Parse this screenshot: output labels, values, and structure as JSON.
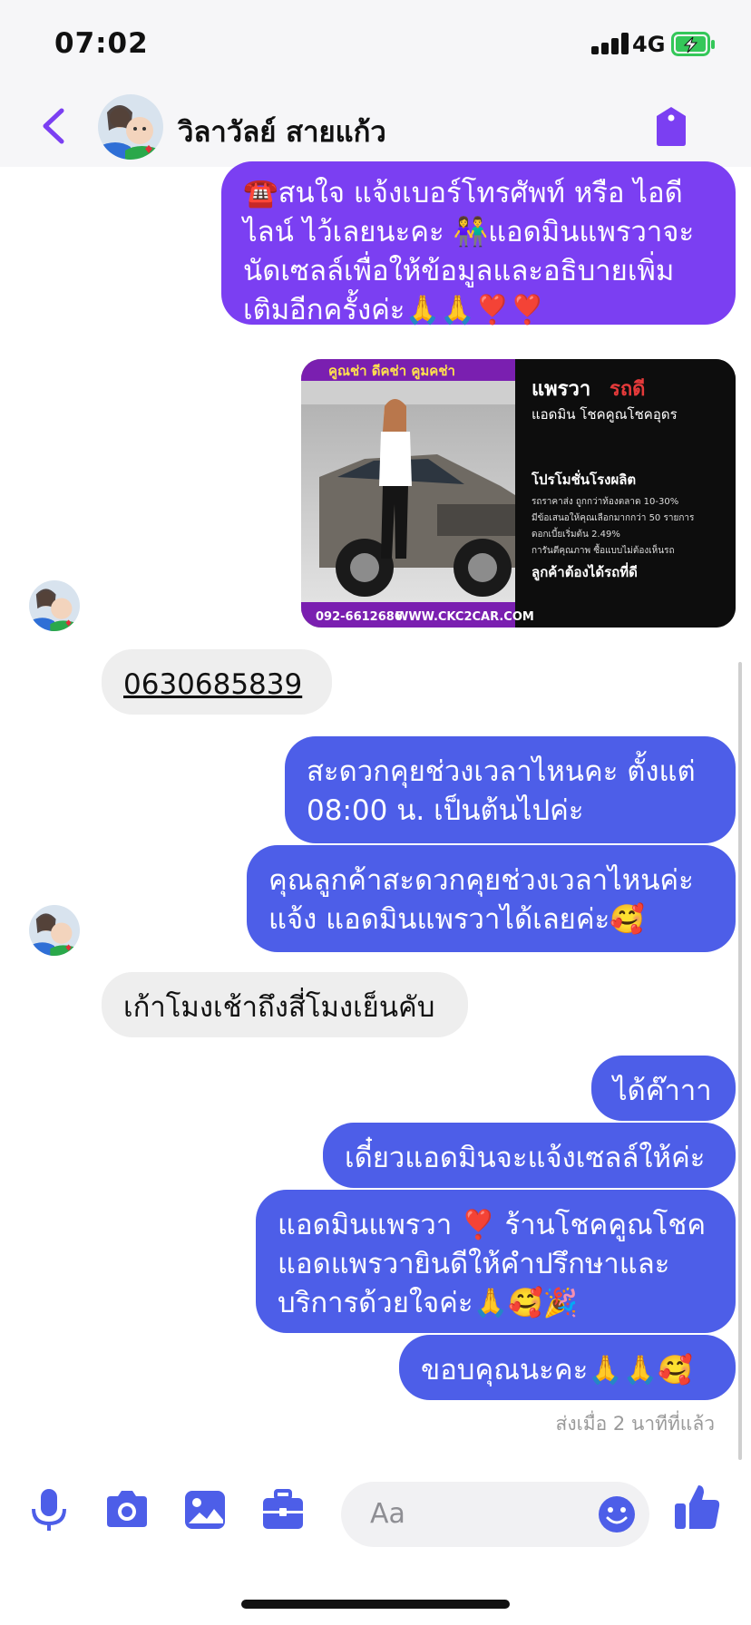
{
  "status": {
    "time": "07:02",
    "network": "4G"
  },
  "header": {
    "contact_name": "วิลาวัลย์ สายแก้ว"
  },
  "colors": {
    "accent": "#7b3ff2",
    "sent_purple": "#7b3ff2",
    "sent_indigo": "#4d5ee8",
    "received_gray": "#eeeeee"
  },
  "messages": {
    "m1": "☎️สนใจ แจ้งเบอร์โทรศัพท์ หรือ ไอดีไลน์  ไว้เลยนะคะ 👫แอดมินแพรวาจะนัดเซลล์เพื่อให้ข้อมูลและอธิบายเพิ่มเติมอีกครั้งค่ะ🙏🙏❣️❣️",
    "m2": "0630685839",
    "m3": "สะดวกคุยช่วงเวลาไหนคะ ตั้งแต่ 08:00 น. เป็นต้นไปค่ะ",
    "m4": "คุณลูกค้าสะดวกคุยช่วงเวลาไหนค่ะแจ้ง แอดมินแพรวาได้เลยค่ะ🥰",
    "m5": "เก้าโมงเช้าถึงสี่โมงเย็นคับ",
    "m6": "ได้ค๊าาา",
    "m7": "เดี๋ยวแอดมินจะแจ้งเซลล์ให้ค่ะ",
    "m8": "แอดมินแพรวา ❣️ ร้านโชคคูณโชคแอดแพรวายินดีให้คำปรึกษาและบริการด้วยใจค่ะ🙏🥰🎉",
    "m9": "ขอบคุณนะคะ🙏🙏🥰"
  },
  "ad": {
    "banner": "คูณช่า ดีคช่า คูมคช่า",
    "brand_1": "แพรวา",
    "brand_2": "รถดี",
    "subtitle": "แอดมิน โชคคูณโชคอุดร",
    "promo_title": "โปรโมชั่นโรงผลิต",
    "line1": "รถราคาส่ง ถูกกว่าท้องตลาด 10-30%",
    "line2": "มีข้อเสนอให้คุณเลือกมากกว่า 50 รายการ",
    "line3": "ดอกเบี้ยเริ่มต้น 2.49%",
    "line4": "การันตีคุณภาพ ซื้อแบบไม่ต้องเห็นรถ",
    "slogan": "ลูกค้าต้องได้รถที่ดี",
    "phone": "092-6612686",
    "website": "WWW.CKC2CAR.COM"
  },
  "sent_status": "ส่งเมื่อ 2 นาทีที่แล้ว",
  "composer": {
    "placeholder": "Aa"
  }
}
